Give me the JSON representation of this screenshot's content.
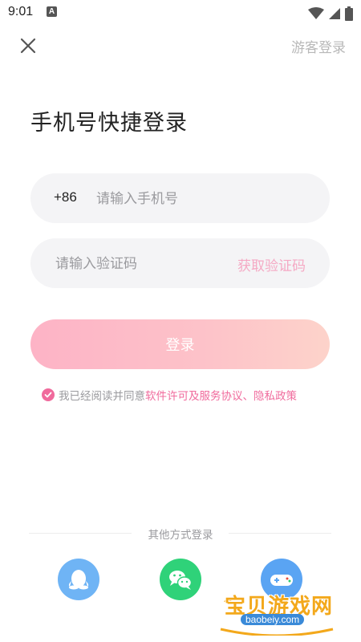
{
  "status_bar": {
    "time": "9:01",
    "notification_letter": "A"
  },
  "header": {
    "close_icon": "close-icon",
    "guest_login_label": "游客登录"
  },
  "title": "手机号快捷登录",
  "phone": {
    "country_code": "+86",
    "placeholder": "请输入手机号",
    "value": ""
  },
  "code": {
    "placeholder": "请输入验证码",
    "value": "",
    "get_code_label": "获取验证码"
  },
  "login_button_label": "登录",
  "agreement": {
    "prefix": "我已经阅读并同意",
    "link": "软件许可及服务协议、隐私政策",
    "checked": true
  },
  "other_login": {
    "title": "其他方式登录",
    "options": [
      {
        "icon": "qq-icon",
        "color": "#6fb4f5"
      },
      {
        "icon": "wechat-icon",
        "color": "#2fd279"
      },
      {
        "icon": "game-icon",
        "color": "#5aa4f3"
      }
    ]
  },
  "watermark": {
    "text": "宝贝游戏网",
    "url": "baobeiy.com"
  },
  "colors": {
    "accent": "#f06a9c",
    "get_code": "#f5a9c4",
    "field_bg": "#f4f4f6"
  }
}
